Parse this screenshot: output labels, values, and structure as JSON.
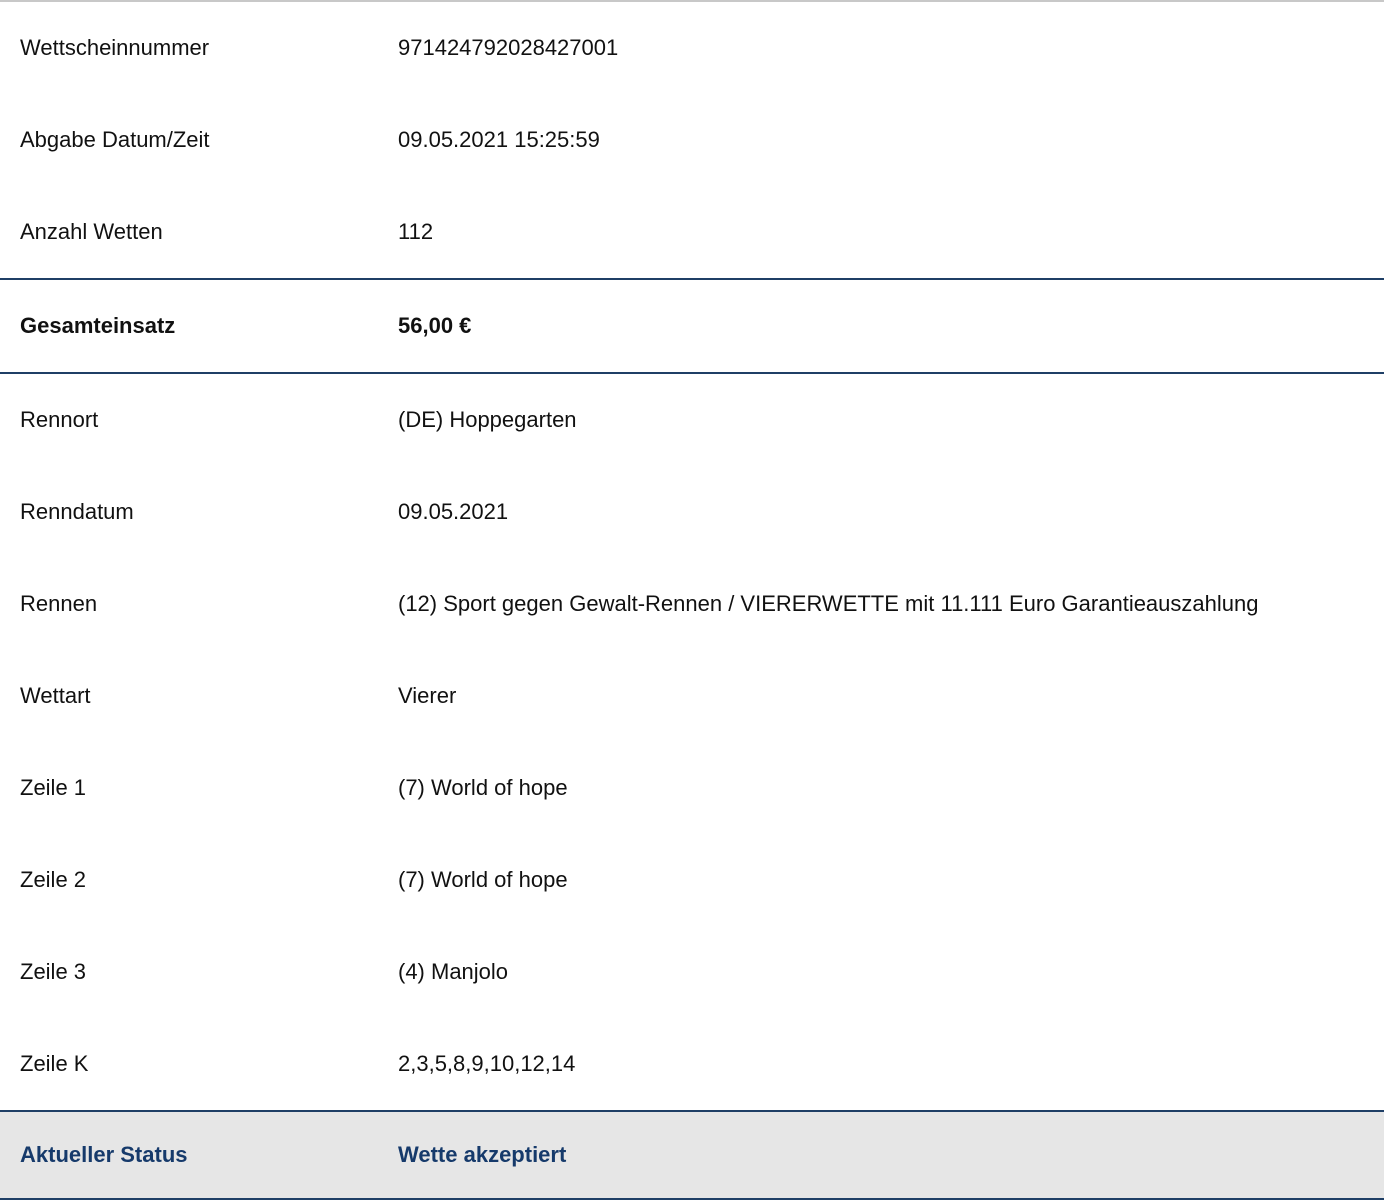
{
  "colors": {
    "divider": "#1f3f66",
    "status_text": "#163a6b",
    "status_background": "#e6e6e6",
    "top_border": "#c8c8c8"
  },
  "ticket": {
    "number": {
      "label": "Wettscheinnummer",
      "value": "971424792028427001"
    },
    "submitted": {
      "label": "Abgabe Datum/Zeit",
      "value": "09.05.2021 15:25:59"
    },
    "bet_count": {
      "label": "Anzahl Wetten",
      "value": "112"
    },
    "total_stake": {
      "label": "Gesamteinsatz",
      "value": "56,00 €"
    },
    "venue": {
      "label": "Rennort",
      "value": "(DE) Hoppegarten"
    },
    "race_date": {
      "label": "Renndatum",
      "value": "09.05.2021"
    },
    "race": {
      "label": "Rennen",
      "value": "(12) Sport gegen Gewalt-Rennen / VIERERWETTE mit 11.111 Euro Garantieauszahlung"
    },
    "bet_type": {
      "label": "Wettart",
      "value": "Vierer"
    },
    "line1": {
      "label": "Zeile 1",
      "value": "(7) World of hope"
    },
    "line2": {
      "label": "Zeile 2",
      "value": "(7) World of hope"
    },
    "line3": {
      "label": "Zeile 3",
      "value": "(4) Manjolo"
    },
    "linek": {
      "label": "Zeile K",
      "value": "2,3,5,8,9,10,12,14"
    },
    "status": {
      "label": "Aktueller Status",
      "value": "Wette akzeptiert"
    }
  }
}
